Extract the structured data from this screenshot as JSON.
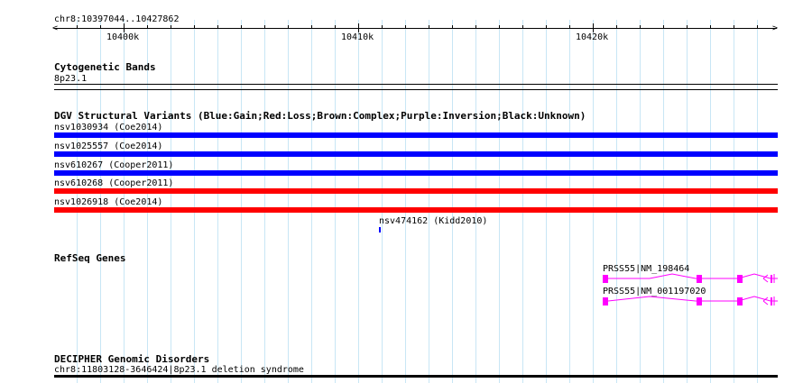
{
  "coordinates": "chr8:10397044..10427862",
  "ruler": {
    "ticks": [
      "10400k",
      "10410k",
      "10420k"
    ]
  },
  "tracks": {
    "cytoband": {
      "title": "Cytogenetic Bands",
      "label": "8p23.1"
    },
    "dgv": {
      "title": "DGV Structural Variants (Blue:Gain;Red:Loss;Brown:Complex;Purple:Inversion;Black:Unknown)",
      "variants": [
        {
          "label": "nsv1030934 (Coe2014)",
          "color": "#0000ff"
        },
        {
          "label": "nsv1025557 (Coe2014)",
          "color": "#0000ff"
        },
        {
          "label": "nsv610267 (Cooper2011)",
          "color": "#0000ff"
        },
        {
          "label": "nsv610268 (Cooper2011)",
          "color": "#ff0000"
        },
        {
          "label": "nsv1026918 (Coe2014)",
          "color": "#ff0000"
        },
        {
          "label": "nsv474162 (Kidd2010)",
          "color": "#0000ff"
        }
      ]
    },
    "refseq": {
      "title": "RefSeq Genes",
      "genes": [
        {
          "label": "PRSS55|NM_198464",
          "color": "#ff00ff"
        },
        {
          "label": "PRSS55|NM_001197020",
          "color": "#ff00ff"
        }
      ]
    },
    "decipher": {
      "title": "DECIPHER Genomic Disorders",
      "label": "chr8:11803128-3646424|8p23.1 deletion syndrome"
    }
  }
}
